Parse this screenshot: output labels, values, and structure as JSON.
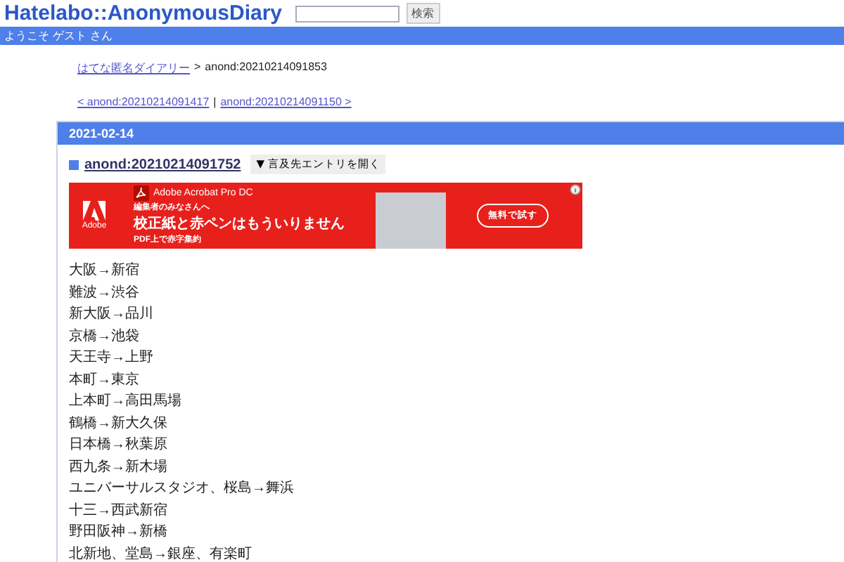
{
  "header": {
    "title": "Hatelabo::AnonymousDiary",
    "search_button": "検索"
  },
  "welcome": "ようこそ ゲスト さん",
  "breadcrumb": {
    "link": "はてな匿名ダイアリー",
    "separator": ">",
    "current": "anond:20210214091853"
  },
  "nav": {
    "prev": "< anond:20210214091417",
    "separator": "|",
    "next": "anond:20210214091150 >"
  },
  "day": {
    "date": "2021-02-14",
    "entry_title": "anond:20210214091752",
    "toggle_button": "▼ 言及先エントリを開く"
  },
  "ad": {
    "logo_text": "Adobe",
    "product": "Adobe Acrobat Pro DC",
    "line1": "編集者のみなさんへ",
    "headline": "校正紙と赤ペンはもういりません",
    "line3": "PDF上で赤字集約",
    "cta": "無料で試す"
  },
  "lines": [
    "大阪→新宿",
    "難波→渋谷",
    "新大阪→品川",
    "京橋→池袋",
    "天王寺→上野",
    "本町→東京",
    "上本町→高田馬場",
    "鶴橋→新大久保",
    "日本橋→秋葉原",
    "西九条→新木場",
    "ユニバーサルスタジオ、桜島→舞浜",
    "十三→西武新宿",
    "野田阪神→新橋",
    "北新地、堂島→銀座、有楽町"
  ]
}
